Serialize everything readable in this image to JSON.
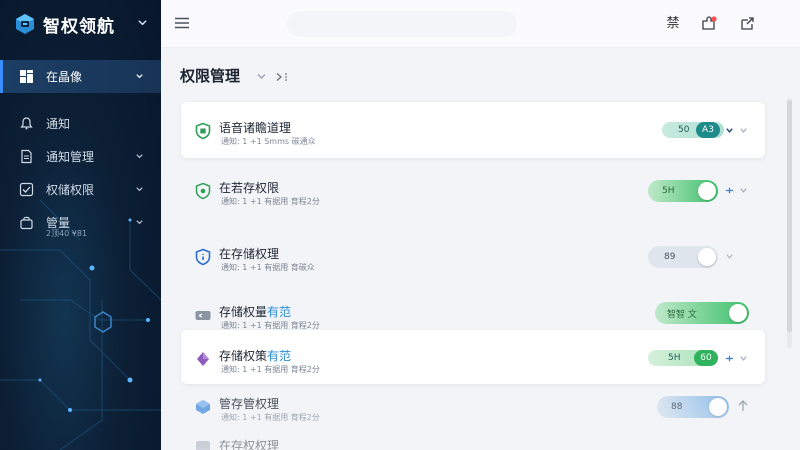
{
  "brand": {
    "name": "智权领航"
  },
  "sidebar": {
    "items": [
      {
        "label": "在晶像",
        "icon": "dashboard-icon",
        "active": true
      },
      {
        "label": "通知",
        "icon": "bell-icon"
      },
      {
        "label": "通知管理",
        "icon": "document-icon"
      },
      {
        "label": "权储权限",
        "icon": "checkbox-icon"
      },
      {
        "label": "管量",
        "icon": "bag-icon",
        "sub": "2顶40 ¥81"
      }
    ]
  },
  "topbar": {
    "action_1": "禁"
  },
  "page": {
    "title": "权限管理"
  },
  "rows": [
    {
      "title": "语音诸瞻道理",
      "title_accent": "",
      "meta": "通知:  1   +1  Smms 碳通众",
      "icon": "shield-check-icon",
      "control": "badge",
      "badge_left": "50",
      "badge_right": "A3"
    },
    {
      "title": "在若存权限",
      "title_accent": "",
      "meta": "通知:  1   +1  有据用 育程2分",
      "icon": "shield-icon",
      "control": "toggle-on",
      "toggle_text": "5H",
      "toggle_level": 1
    },
    {
      "title": "在存储权理",
      "title_accent": "",
      "meta": "通知:  1   +1  有据用 育碳众",
      "icon": "shield-info-icon",
      "control": "toggle-off",
      "toggle_text": "89",
      "toggle_level": 0
    },
    {
      "title": "存储权量",
      "title_accent": "有范",
      "meta": "通知:  1   +1  有据用 育程2分",
      "icon": "key-icon",
      "control": "toggle-on",
      "toggle_text": "智智 文",
      "toggle_level": 1
    },
    {
      "title": "存储权策",
      "title_accent": "有范",
      "meta": "通知:  1   +1  有据用 育程2分",
      "icon": "diamond-icon",
      "control": "badge-green",
      "badge_left": "5H",
      "badge_right": "60"
    },
    {
      "title": "管存管权理",
      "title_accent": "",
      "meta": "通知:  1   +1  有据用 育程2分",
      "icon": "cube-icon",
      "control": "toggle-blue",
      "toggle_text": "88",
      "toggle_level": 1
    },
    {
      "title": "在存权权理",
      "title_accent": "",
      "meta": "",
      "icon": "folder-icon",
      "control": "none"
    }
  ],
  "colors": {
    "accent": "#3a8dff",
    "sidebar_bg": "#0c1f35",
    "toggle_on": "#3cc06a",
    "badge_dark": "#1f8a8a"
  }
}
